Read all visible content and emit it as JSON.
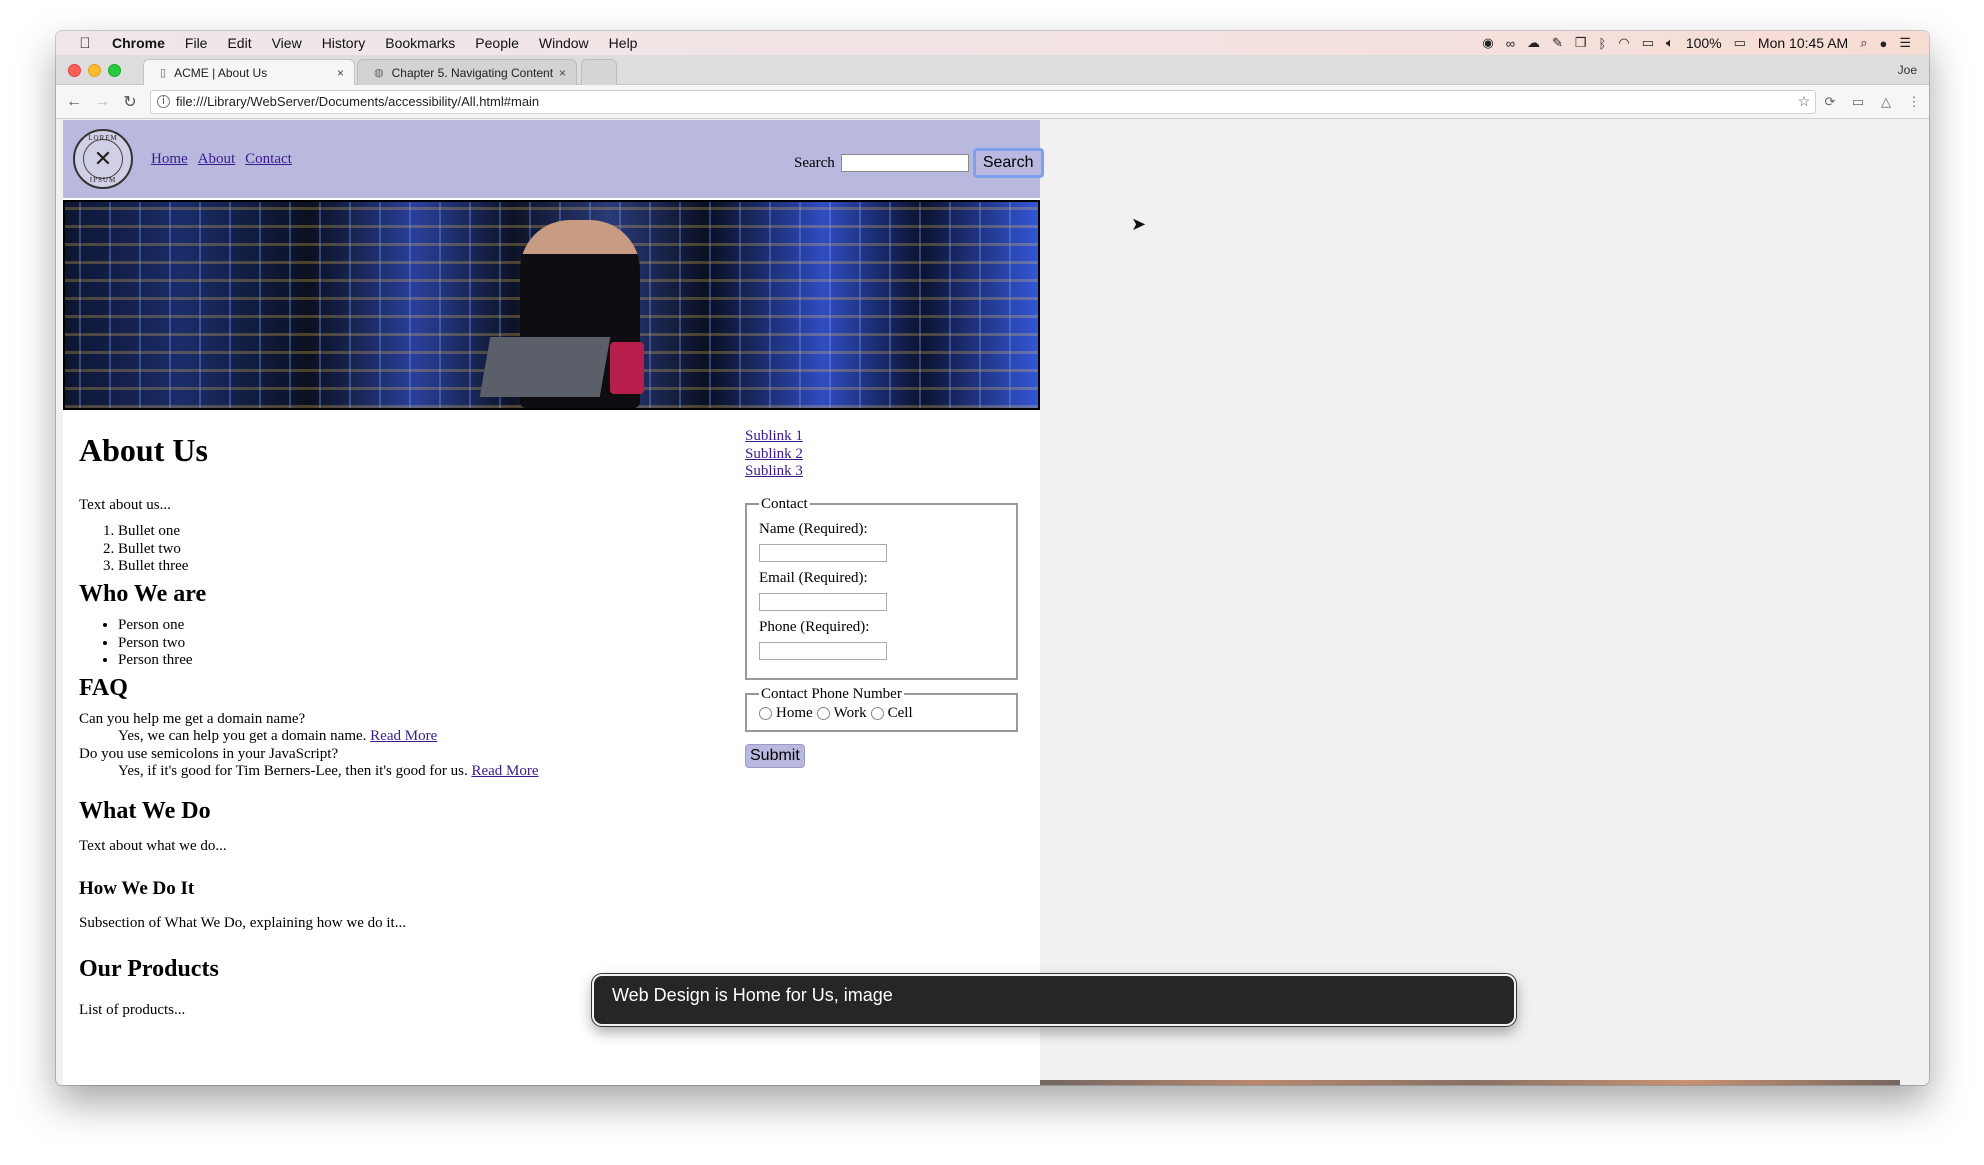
{
  "menubar": {
    "apple": "",
    "items": [
      "Chrome",
      "File",
      "Edit",
      "View",
      "History",
      "Bookmarks",
      "People",
      "Window",
      "Help"
    ],
    "battery": "100%",
    "clock": "Mon 10:45 AM"
  },
  "tabs": [
    {
      "label": "ACME | About Us",
      "close": "×"
    },
    {
      "label": "Chapter 5. Navigating Content",
      "close": "×"
    }
  ],
  "profile": "Joe",
  "address": {
    "url": "file:///Library/WebServer/Documents/accessibility/All.html#main"
  },
  "site": {
    "logo_top": "LOREM",
    "logo_bottom": "IPSUM",
    "nav": [
      "Home",
      "About",
      "Contact"
    ],
    "search_label": "Search",
    "search_button": "Search"
  },
  "main": {
    "title": "About Us",
    "intro": "Text about us...",
    "ordered": [
      "Bullet one",
      "Bullet two",
      "Bullet three"
    ],
    "who_heading": "Who We are",
    "people": [
      "Person one",
      "Person two",
      "Person three"
    ],
    "faq_heading": "FAQ",
    "faq": [
      {
        "q": "Can you help me get a domain name?",
        "a": "Yes, we can help you get a domain name.",
        "more": "Read More"
      },
      {
        "q": "Do you use semicolons in your JavaScript?",
        "a": "Yes, if it's good for Tim Berners-Lee, then it's good for us.",
        "more": "Read More"
      }
    ],
    "what_heading": "What We Do",
    "what_text": "Text about what we do...",
    "how_heading": "How We Do It",
    "how_text": "Subsection of What We Do, explaining how we do it...",
    "products_heading": "Our Products",
    "products_text": "List of products..."
  },
  "aside": {
    "sublinks": [
      "Sublink 1",
      "Sublink 2",
      "Sublink 3"
    ],
    "contact_legend": "Contact",
    "fields": [
      "Name (Required):",
      "Email (Required):",
      "Phone (Required):"
    ],
    "phone_legend": "Contact Phone Number",
    "radios": [
      "Home",
      "Work",
      "Cell"
    ],
    "submit": "Submit"
  },
  "voiceover": "Web Design is Home for Us, image"
}
